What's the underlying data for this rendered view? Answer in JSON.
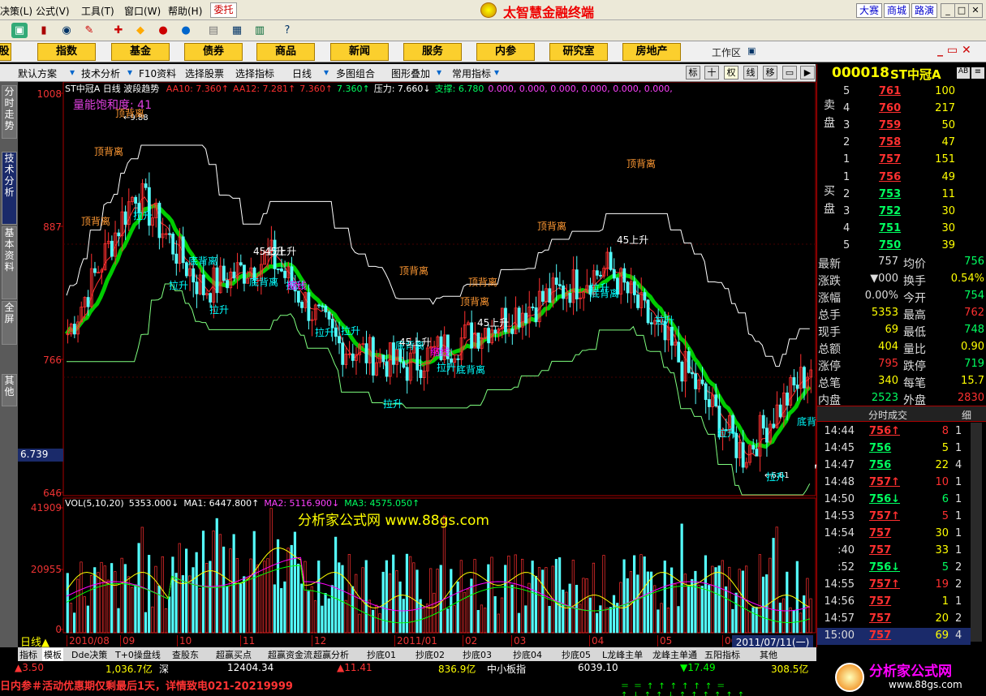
{
  "menu": {
    "items": [
      "决策(L)",
      "公式(V)",
      "工具(T)",
      "窗口(W)",
      "帮助(H)"
    ],
    "entrust": "委托",
    "brand": "太智慧金融终端",
    "right_buttons": [
      "大赛",
      "商城",
      "路演"
    ]
  },
  "nav": {
    "buttons": [
      "股",
      "指数",
      "基金",
      "债券",
      "商品",
      "新闻",
      "服务",
      "内参",
      "研究室",
      "房地产"
    ],
    "workarea": "工作区"
  },
  "ctool": {
    "items": [
      "默认方案",
      "技术分析",
      "F10资料",
      "选择股票",
      "选择指标",
      "日线",
      "多图组合",
      "图形叠加",
      "常用指标"
    ],
    "right_buttons": [
      "标",
      "十",
      "权",
      "线",
      "移"
    ]
  },
  "left_tabs": [
    "分时走势",
    "技术分析",
    "基本资料",
    "全屏",
    "其他"
  ],
  "chart": {
    "title_code": "ST中冠A",
    "period": "日线",
    "indicator": "波段趋势",
    "legend": [
      {
        "label": "AA10: 7.360↑",
        "color": "#ff3030"
      },
      {
        "label": "AA12: 7.281↑",
        "color": "#ff3030"
      },
      {
        "label": "7.360↑",
        "color": "#ff3030"
      },
      {
        "label": "7.360↑",
        "color": "#00ff60"
      },
      {
        "label": "压力: 7.660↓",
        "color": "#ffffff"
      },
      {
        "label": "支撑: 6.780",
        "color": "#00ff60"
      },
      {
        "label": "0.000, 0.000, 0.000, 0.000, 0.000, 0.000,",
        "color": "#ff40ff"
      }
    ],
    "saturation": "量能饱和度: 41",
    "y_labels": [
      "1008",
      "887",
      "766",
      "646"
    ],
    "crosshair_value": "6.739",
    "price_high": "9.88",
    "price_low": "6.61",
    "annotations": [
      "顶背离",
      "顶背离",
      "顶背离",
      "顶背离",
      "顶背离",
      "顶背离",
      "顶背离",
      "顶背离",
      "底背离",
      "底背离",
      "底背离",
      "底背离",
      "底背离",
      "底背",
      "拉升",
      "拉升",
      "拉升",
      "拉升",
      "拉升",
      "拉升",
      "拉升",
      "拉升",
      "拉升",
      "拉升",
      "拉升",
      "拉升",
      "45上升",
      "45上升",
      "45上升",
      "45上升",
      "45上升",
      "缩线",
      "缩线"
    ],
    "vol_legend": [
      {
        "label": "VOL(5,10,20)",
        "color": "#ffffff"
      },
      {
        "label": "5353.000↓",
        "color": "#ffffff"
      },
      {
        "label": "MA1: 6447.800↑",
        "color": "#ffffff"
      },
      {
        "label": "MA2: 5116.900↓",
        "color": "#ff40ff"
      },
      {
        "label": "MA3: 4575.050↑",
        "color": "#00ff60"
      }
    ],
    "vol_y": [
      "41909",
      "20955",
      "0"
    ],
    "watermark": "分析家公式网 www.88gs.com",
    "x_labels": [
      "2010/08",
      "09",
      "10",
      "11",
      "12",
      "2011/01",
      "02",
      "03",
      "04",
      "05",
      "06"
    ],
    "date_badge": "2011/07/11(一)",
    "period_tag": "日线"
  },
  "chart_data": {
    "type": "candlestick",
    "x": [
      "2010/08",
      "09",
      "10",
      "11",
      "12",
      "2011/01",
      "02",
      "03",
      "04",
      "05",
      "06",
      "2011/07"
    ],
    "close": [
      7.9,
      9.2,
      8.3,
      8.6,
      7.8,
      7.6,
      7.9,
      8.2,
      8.5,
      7.7,
      6.8,
      7.6
    ],
    "ylim": [
      6.46,
      10.08
    ],
    "high": 9.88,
    "low": 6.61
  },
  "quote": {
    "code": "000018",
    "name": "ST中冠A",
    "ask": [
      {
        "n": "5",
        "p": "761",
        "v": "100"
      },
      {
        "n": "4",
        "p": "760",
        "v": "217"
      },
      {
        "n": "3",
        "p": "759",
        "v": "50"
      },
      {
        "n": "2",
        "p": "758",
        "v": "47"
      },
      {
        "n": "1",
        "p": "757",
        "v": "151"
      }
    ],
    "bid": [
      {
        "n": "1",
        "p": "756",
        "v": "49"
      },
      {
        "n": "2",
        "p": "753",
        "v": "11"
      },
      {
        "n": "3",
        "p": "752",
        "v": "30"
      },
      {
        "n": "4",
        "p": "751",
        "v": "30"
      },
      {
        "n": "5",
        "p": "750",
        "v": "39"
      }
    ],
    "ask_label": "卖盘",
    "bid_label": "买盘",
    "stats": [
      {
        "l": "最新",
        "v": "757",
        "l2": "均价",
        "v2": "756"
      },
      {
        "l": "涨跌",
        "v": "▼000",
        "l2": "换手",
        "v2": "0.54%"
      },
      {
        "l": "涨幅",
        "v": "0.00%",
        "l2": "今开",
        "v2": "754"
      },
      {
        "l": "总手",
        "v": "5353",
        "l2": "最高",
        "v2": "762"
      },
      {
        "l": "现手",
        "v": "69",
        "l2": "最低",
        "v2": "748"
      },
      {
        "l": "总额",
        "v": "404",
        "l2": "量比",
        "v2": "0.90"
      },
      {
        "l": "涨停",
        "v": "795",
        "l2": "跌停",
        "v2": "719"
      },
      {
        "l": "总笔",
        "v": "340",
        "l2": "每笔",
        "v2": "15.7"
      },
      {
        "l": "内盘",
        "v": "2523",
        "l2": "外盘",
        "v2": "2830"
      }
    ],
    "tabs": [
      "分时成交",
      "细"
    ],
    "trades": [
      {
        "t": "14:44",
        "p": "756↑",
        "v": "8",
        "n": "1"
      },
      {
        "t": "14:45",
        "p": "756",
        "v": "5",
        "n": "1"
      },
      {
        "t": "14:47",
        "p": "756",
        "v": "22",
        "n": "4"
      },
      {
        "t": "14:48",
        "p": "757↑",
        "v": "10",
        "n": "1"
      },
      {
        "t": "14:50",
        "p": "756↓",
        "v": "6",
        "n": "1"
      },
      {
        "t": "14:53",
        "p": "757↑",
        "v": "5",
        "n": "1"
      },
      {
        "t": "14:54",
        "p": "757",
        "v": "30",
        "n": "1"
      },
      {
        "t": ":40",
        "p": "757",
        "v": "33",
        "n": "1"
      },
      {
        "t": ":52",
        "p": "756↓",
        "v": "5",
        "n": "2"
      },
      {
        "t": "14:55",
        "p": "757↑",
        "v": "19",
        "n": "2"
      },
      {
        "t": "14:56",
        "p": "757",
        "v": "1",
        "n": "1"
      },
      {
        "t": "14:57",
        "p": "757",
        "v": "20",
        "n": "2"
      },
      {
        "t": "15:00",
        "p": "757",
        "v": "69",
        "n": "4"
      }
    ]
  },
  "bottom_tabs": [
    "指标",
    "模板",
    "Dde决策",
    "T+0操盘线",
    "查股东",
    "超赢买点",
    "超赢资金流",
    "超赢分析",
    "抄底01",
    "抄底02",
    "抄底03",
    "抄底04",
    "抄底05",
    "L龙峰主单",
    "龙峰主单通",
    "五阳指标",
    "其他"
  ],
  "status": {
    "items": [
      "▲3.50",
      "1,036.7亿",
      "深",
      "12404.34",
      "▲11.41",
      "836.9亿",
      "中小板指",
      "6039.10",
      "▼17.49",
      "308.5亿"
    ],
    "ticker": "日内参＃活动优惠期仅剩最后1天，详情致电021-20219999",
    "site_logo": "分析家公式网",
    "site_url": "www.88gs.com"
  }
}
